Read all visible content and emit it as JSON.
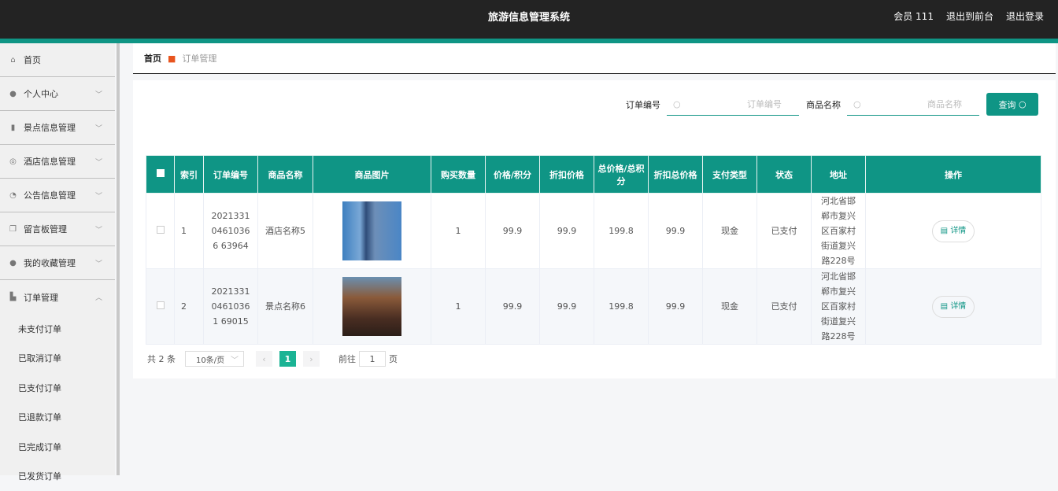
{
  "header": {
    "title": "旅游信息管理系统",
    "user": "会员 111",
    "to_front": "退出到前台",
    "logout": "退出登录"
  },
  "sidebar": {
    "items": [
      {
        "label": "首页",
        "icon": "home-icon"
      },
      {
        "label": "个人中心",
        "icon": "user-icon"
      },
      {
        "label": "景点信息管理",
        "icon": "book-icon"
      },
      {
        "label": "酒店信息管理",
        "icon": "hotel-icon"
      },
      {
        "label": "公告信息管理",
        "icon": "gauge-icon"
      },
      {
        "label": "留言板管理",
        "icon": "copy-icon"
      },
      {
        "label": "我的收藏管理",
        "icon": "pin-icon"
      },
      {
        "label": "订单管理",
        "icon": "cart-icon"
      }
    ],
    "subitems": [
      "未支付订单",
      "已取消订单",
      "已支付订单",
      "已退款订单",
      "已完成订单",
      "已发货订单"
    ]
  },
  "breadcrumb": {
    "home": "首页",
    "current": "订单管理"
  },
  "search": {
    "order_label": "订单编号",
    "order_placeholder": "订单编号",
    "name_label": "商品名称",
    "name_placeholder": "商品名称",
    "button": "查询"
  },
  "table": {
    "headers": [
      "索引",
      "订单编号",
      "商品名称",
      "商品图片",
      "购买数量",
      "价格/积分",
      "折扣价格",
      "总价格/总积分",
      "折扣总价格",
      "支付类型",
      "状态",
      "地址",
      "操作"
    ],
    "rows": [
      {
        "index": "1",
        "order_no": "202133104610366 63964",
        "name": "酒店名称5",
        "qty": "1",
        "price": "99.9",
        "disc": "99.9",
        "total": "199.8",
        "disc_total": "99.9",
        "pay": "现金",
        "status": "已支付",
        "addr": "河北省邯郸市复兴区百家村街道复兴路228号",
        "action": "详情"
      },
      {
        "index": "2",
        "order_no": "202133104610361 69015",
        "name": "景点名称6",
        "qty": "1",
        "price": "99.9",
        "disc": "99.9",
        "total": "199.8",
        "disc_total": "99.9",
        "pay": "现金",
        "status": "已支付",
        "addr": "河北省邯郸市复兴区百家村街道复兴路228号",
        "action": "详情"
      }
    ]
  },
  "pager": {
    "total": "共 2 条",
    "size": "10条/页",
    "page": "1",
    "goto": "前往",
    "goto_value": "1",
    "page_suffix": "页"
  }
}
